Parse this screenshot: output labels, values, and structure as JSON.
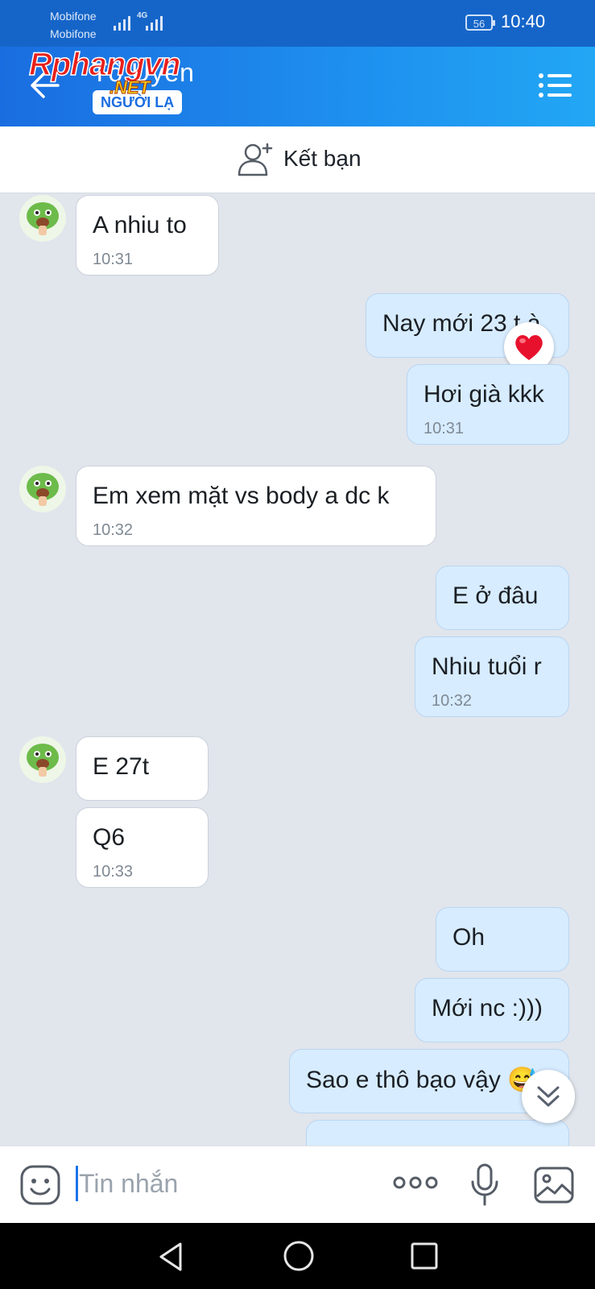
{
  "status_bar": {
    "carrier_1": "Mobifone",
    "carrier_2": "Mobifone",
    "network_type": "4G",
    "battery": "56",
    "time": "10:40"
  },
  "header": {
    "contact_name": "Tố Uyên",
    "stranger_badge": "NGƯỜI LẠ",
    "watermark_logo": "Rphangvn .NET",
    "accent_color": "#1e88e5"
  },
  "friend_bar": {
    "add_friend_label": "Kết bạn"
  },
  "messages": [
    {
      "id": "m1",
      "side": "incoming",
      "text": "A nhiu to",
      "time": "10:31"
    },
    {
      "id": "m2",
      "side": "outgoing",
      "text": "Nay mới 23 t à",
      "time": "",
      "reaction": "heart"
    },
    {
      "id": "m3",
      "side": "outgoing",
      "text": "Hơi già kkk",
      "time": "10:31"
    },
    {
      "id": "m4",
      "side": "incoming",
      "text": "Em xem mặt vs body a dc k",
      "time": "10:32"
    },
    {
      "id": "m5",
      "side": "outgoing",
      "text": "E ở đâu",
      "time": ""
    },
    {
      "id": "m6",
      "side": "outgoing",
      "text": "Nhiu tuổi r",
      "time": "10:32"
    },
    {
      "id": "m7",
      "side": "incoming",
      "text": "E 27t",
      "time": ""
    },
    {
      "id": "m8",
      "side": "incoming",
      "text": "Q6",
      "time": "10:33"
    },
    {
      "id": "m9",
      "side": "outgoing",
      "text": "Oh",
      "time": ""
    },
    {
      "id": "m10",
      "side": "outgoing",
      "text": "Mới nc :)))",
      "time": ""
    },
    {
      "id": "m11",
      "side": "outgoing",
      "text": "Sao e thô bạo vậy 😅",
      "time": ""
    }
  ],
  "input_bar": {
    "placeholder": "Tin nhắn",
    "value": ""
  },
  "icons": {
    "back": "arrow-left-icon",
    "menu": "hamburger-menu-icon",
    "add_friend": "add-person-icon",
    "emoji": "sticker-smile-icon",
    "more": "more-dots-icon",
    "mic": "microphone-icon",
    "image": "image-icon",
    "reaction": "heart-icon",
    "scroll_down": "double-chevron-down-icon"
  }
}
